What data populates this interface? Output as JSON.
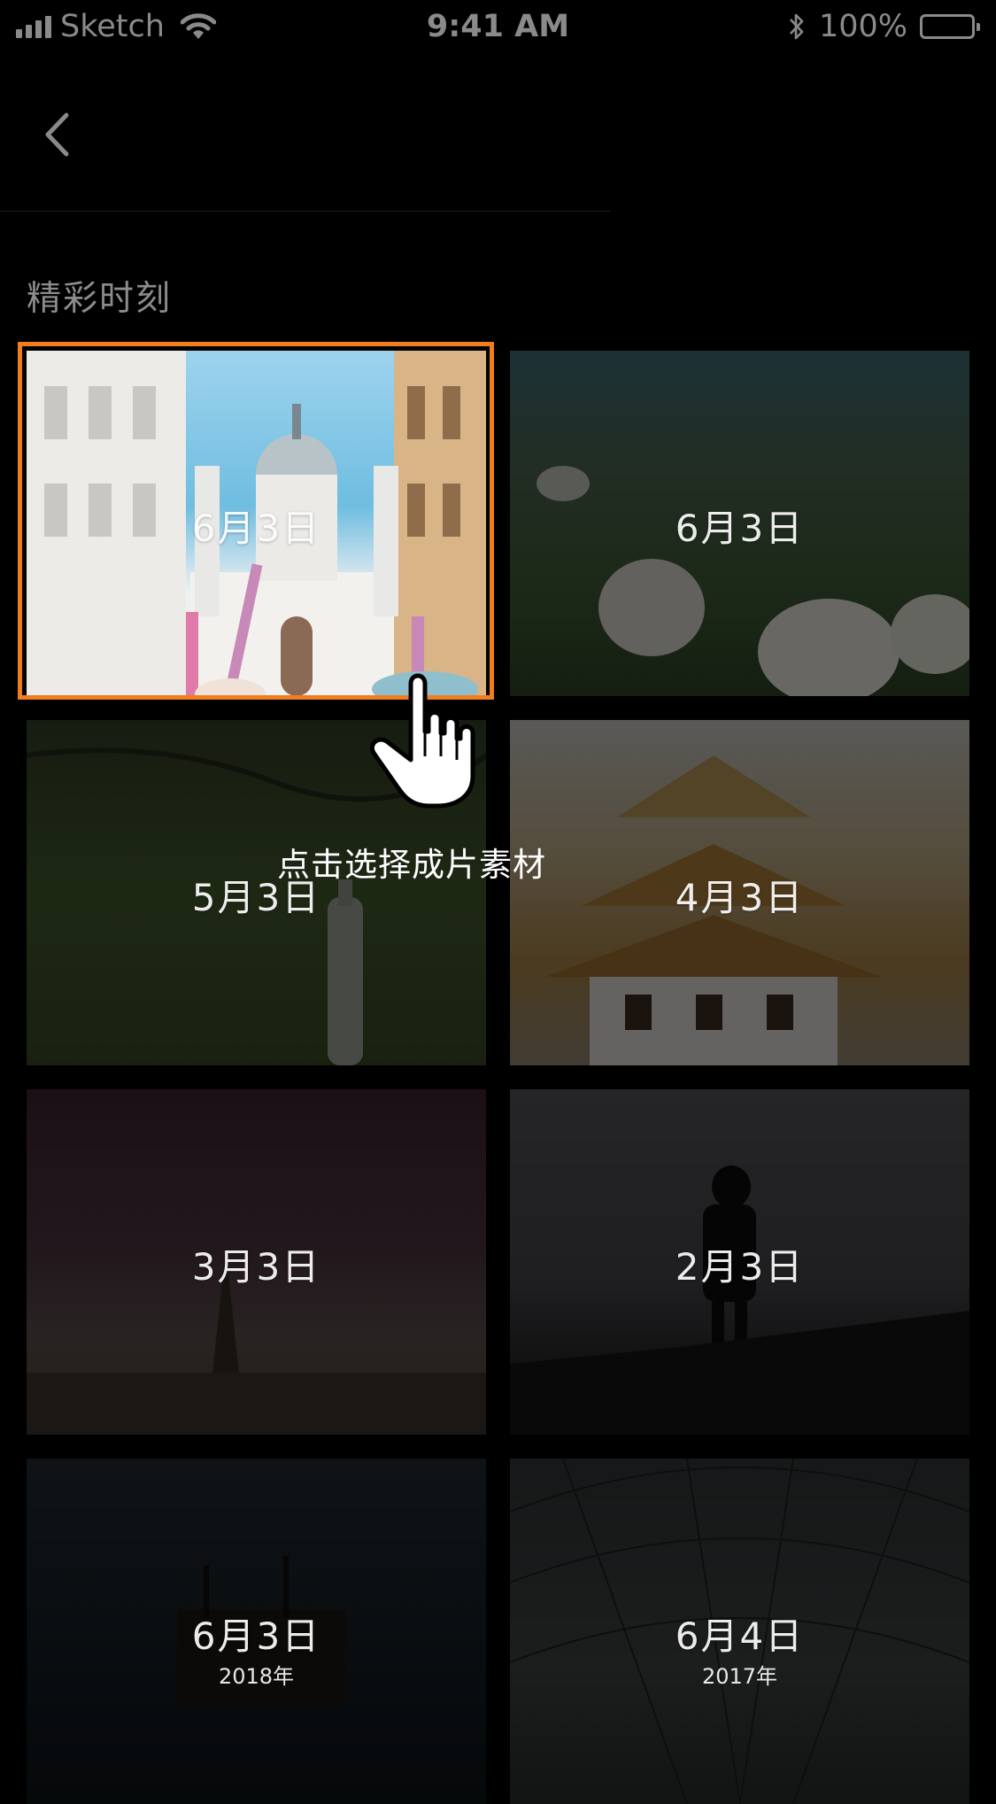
{
  "status_bar": {
    "carrier": "Sketch",
    "time": "9:41 AM",
    "battery": "100%"
  },
  "nav": {
    "back_icon": "chevron-left-icon"
  },
  "section": {
    "title": "精彩时刻"
  },
  "tiles": [
    {
      "date": "6月3日",
      "year": "",
      "dim": 0.0
    },
    {
      "date": "6月3日",
      "year": "",
      "dim": 0.55
    },
    {
      "date": "5月3日",
      "year": "",
      "dim": 0.62
    },
    {
      "date": "4月3日",
      "year": "",
      "dim": 0.58
    },
    {
      "date": "3月3日",
      "year": "",
      "dim": 0.78
    },
    {
      "date": "2月3日",
      "year": "",
      "dim": 0.78
    },
    {
      "date": "6月3日",
      "year": "2018年",
      "dim": 0.86
    },
    {
      "date": "6月4日",
      "year": "2017年",
      "dim": 0.86
    }
  ],
  "hint": {
    "text": "点击选择成片素材",
    "icon": "tap-hand-icon"
  },
  "colors": {
    "selected_border": "#f07e1f",
    "background": "#000000",
    "status_text": "#8a8a8a"
  }
}
